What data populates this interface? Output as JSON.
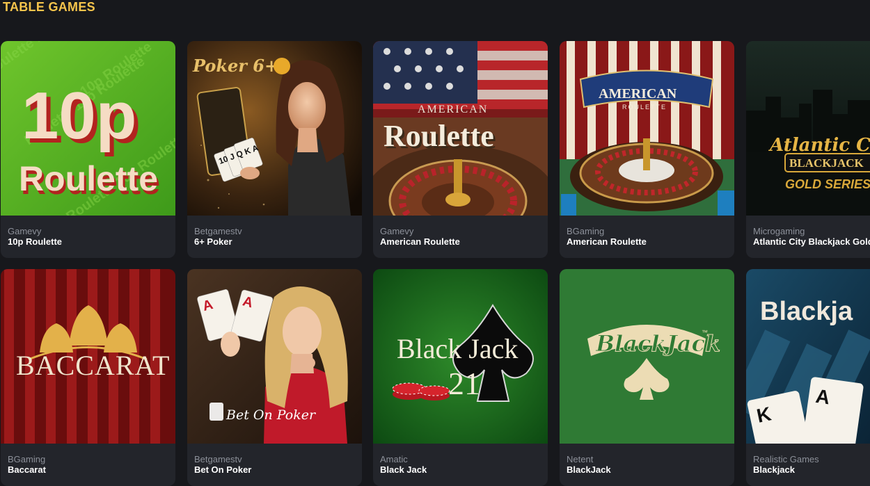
{
  "section": {
    "title": "TABLE GAMES"
  },
  "games": [
    {
      "provider": "Gamevy",
      "name": "10p Roulette",
      "art": {
        "line1": "10p",
        "line2": "Roulette",
        "bg": "tilted text pattern"
      }
    },
    {
      "provider": "Betgamestv",
      "name": "6+ Poker",
      "art": {
        "logo": "Poker 6+",
        "cards": "10 J Q K A"
      }
    },
    {
      "provider": "Gamevy",
      "name": "American Roulette",
      "art": {
        "line1": "AMERICAN",
        "line2": "Roulette"
      }
    },
    {
      "provider": "BGaming",
      "name": "American Roulette",
      "art": {
        "line1": "AMERICAN",
        "line2": "ROULETTE"
      }
    },
    {
      "provider": "Microgaming",
      "name": "Atlantic City Blackjack Gold",
      "art": {
        "line1": "Atlantic City",
        "line2": "BLACKJACK",
        "line3": "GOLD SERIES"
      }
    },
    {
      "provider": "BGaming",
      "name": "Baccarat",
      "art": {
        "line1": "BACCARAT"
      }
    },
    {
      "provider": "Betgamestv",
      "name": "Bet On Poker",
      "art": {
        "logo": "Bet On Poker",
        "card1": "A",
        "card2": "A"
      }
    },
    {
      "provider": "Amatic",
      "name": "Black Jack",
      "art": {
        "line1": "Black Jack",
        "line2": "21"
      }
    },
    {
      "provider": "Netent",
      "name": "BlackJack",
      "art": {
        "line1": "BlackJack",
        "tm": "™"
      }
    },
    {
      "provider": "Realistic Games",
      "name": "Blackjack",
      "art": {
        "line1": "Blackja",
        "card1": "K",
        "card2": "A"
      }
    }
  ]
}
